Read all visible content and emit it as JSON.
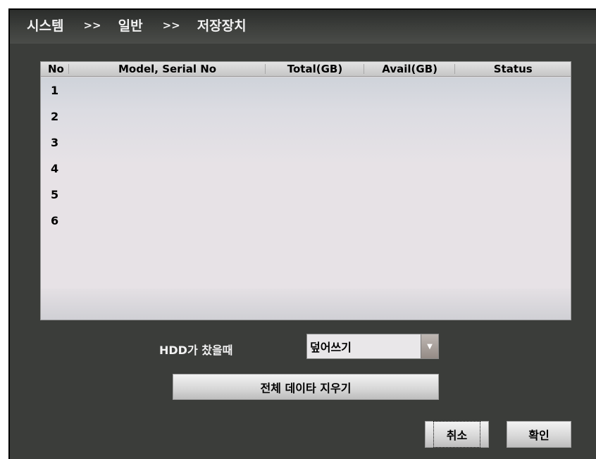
{
  "breadcrumb": {
    "items": [
      "시스템",
      "일반",
      "저장장치"
    ],
    "separator": ">>"
  },
  "table": {
    "columns": [
      "No",
      "Model, Serial No",
      "Total(GB)",
      "Avail(GB)",
      "Status"
    ],
    "rows": [
      {
        "no": "1"
      },
      {
        "no": "2"
      },
      {
        "no": "3"
      },
      {
        "no": "4"
      },
      {
        "no": "5"
      },
      {
        "no": "6"
      }
    ]
  },
  "hdd_full": {
    "label": "HDD가 찼을때",
    "selected": "덮어쓰기",
    "arrow_icon": "chevron-down-icon"
  },
  "buttons": {
    "clear_all": "전체 데이타 지우기",
    "cancel": "취소",
    "ok": "확인"
  },
  "colors": {
    "window_bg": "#3b3d3a",
    "table_bg": "#e7e2e6",
    "text_light": "#f2f2f2"
  }
}
